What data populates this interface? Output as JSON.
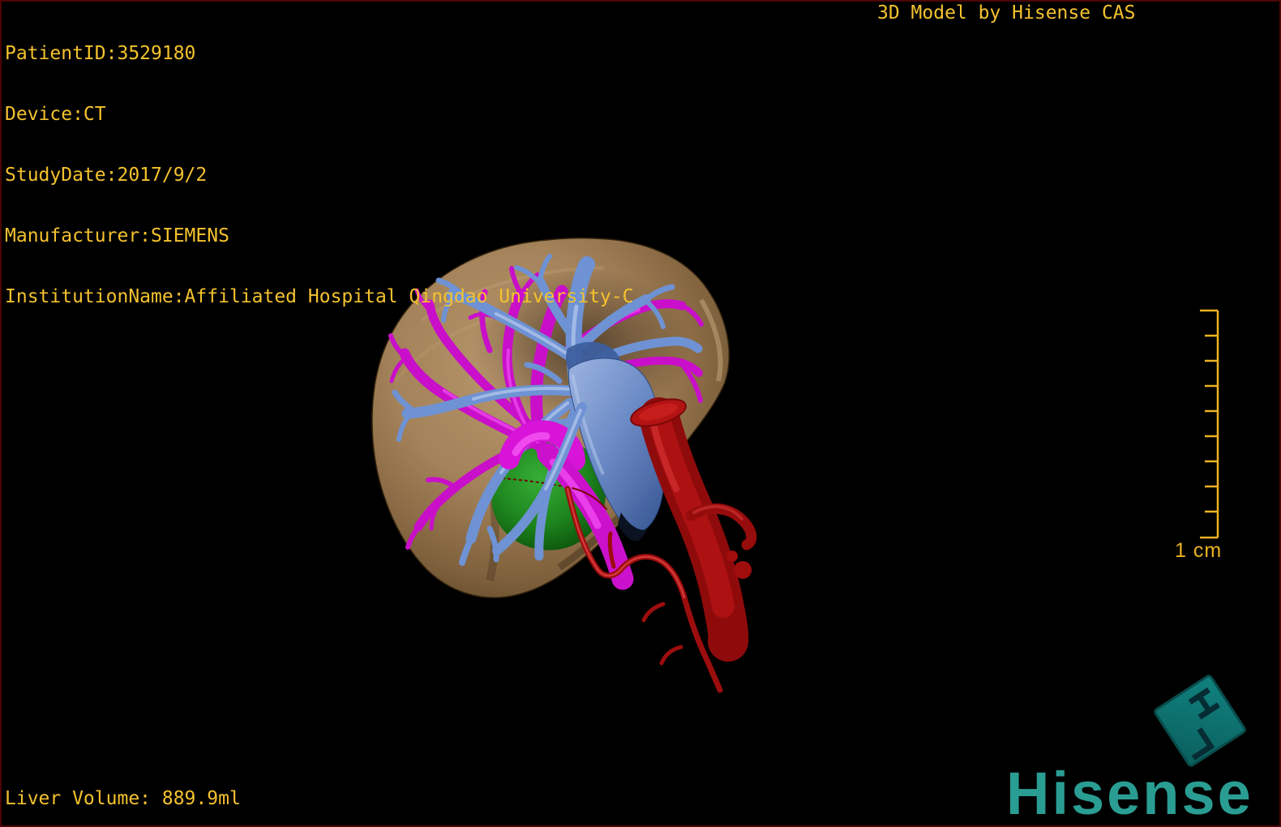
{
  "overlay": {
    "text_color": "#f4c22e",
    "patient_lines": [
      "PatientID:3529180",
      "Device:CT",
      "StudyDate:2017/9/2",
      "Manufacturer:SIEMENS",
      "InstitutionName:Affiliated Hospital Qingdao University-C"
    ],
    "watermark": "3D Model by Hisense CAS",
    "liver_volume": "Liver Volume: 889.9ml"
  },
  "scale_bar": {
    "label": "1 cm",
    "tick_count": 10,
    "color": "#ecb322"
  },
  "model": {
    "structures": [
      {
        "name": "liver",
        "color": "#a8855b"
      },
      {
        "name": "hepatic-veins-ivc",
        "color": "#6e92d3"
      },
      {
        "name": "portal-vein",
        "color": "#c90fc9"
      },
      {
        "name": "hepatic-artery-aorta",
        "color": "#a30e0e"
      },
      {
        "name": "tumor",
        "color": "#1d851d"
      }
    ]
  },
  "branding": {
    "logo_text": "Hisense",
    "logo_color": "#2a9d93",
    "badge_letter_h": "H",
    "badge_letter_l": "L"
  }
}
